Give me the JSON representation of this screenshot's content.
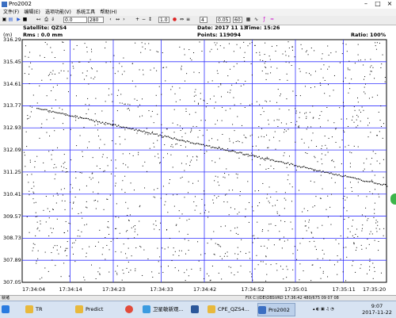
{
  "window": {
    "title": "Pro2002"
  },
  "menu": [
    "文件(F)",
    "编辑(E)",
    "选项功能(V)",
    "系统工具",
    "帮助(H)"
  ],
  "toolbar": {
    "field1": "0.0",
    "field2": "280",
    "zoom": "1.0",
    "count": "4",
    "scale": "0.05",
    "level": "60"
  },
  "header": {
    "satellite": "Satellite: QZS4",
    "rms": "Rms :   0.0 mm",
    "date": "Date: 2017 11 13",
    "time": "Time: 15:26",
    "points": "Points: 119094",
    "ratio": "Ratio: 100%"
  },
  "chart_data": {
    "type": "scatter",
    "ylabel": "(m)",
    "ylim": [
      307.05,
      316.29
    ],
    "y_ticks": [
      "316.29",
      "315.45",
      "314.61",
      "313.77",
      "312.93",
      "312.09",
      "311.25",
      "310.41",
      "309.57",
      "308.73",
      "307.89",
      "307.05"
    ],
    "x_ticks": [
      "17:34:04",
      "17:34:14",
      "17:34:23",
      "17:34:33",
      "17:34:42",
      "17:34:52",
      "17:35:01",
      "17:35:11",
      "17:35:20"
    ],
    "trend_start": {
      "x": "17:34:07",
      "y": 313.7
    },
    "trend_end": {
      "x": "17:35:20",
      "y": 310.75
    }
  },
  "status_bar": {
    "left": "就绪",
    "right": "FIX  C:\\IDE\\OBSVRD   17:36:42 480/675    09 07 08"
  },
  "taskbar": {
    "items": [
      {
        "label": "TR",
        "icon": "folder-icon"
      },
      {
        "label": "Predict",
        "icon": "folder-icon"
      },
      {
        "label": "",
        "icon": "chrome-icon"
      },
      {
        "label": "卫星敏新观...",
        "icon": "app-icon"
      },
      {
        "label": "",
        "icon": "word-icon"
      },
      {
        "label": "CPE_QZS4...",
        "icon": "folder-icon"
      },
      {
        "label": "Pro2002",
        "icon": "app-icon"
      }
    ],
    "clock_time": "9:07",
    "clock_date": "2017-11-22"
  },
  "colors": {
    "grid": "#3434ff",
    "trend": "#000000",
    "taskbar": "#d7e3f2",
    "accent_green": "#3cb54a"
  }
}
